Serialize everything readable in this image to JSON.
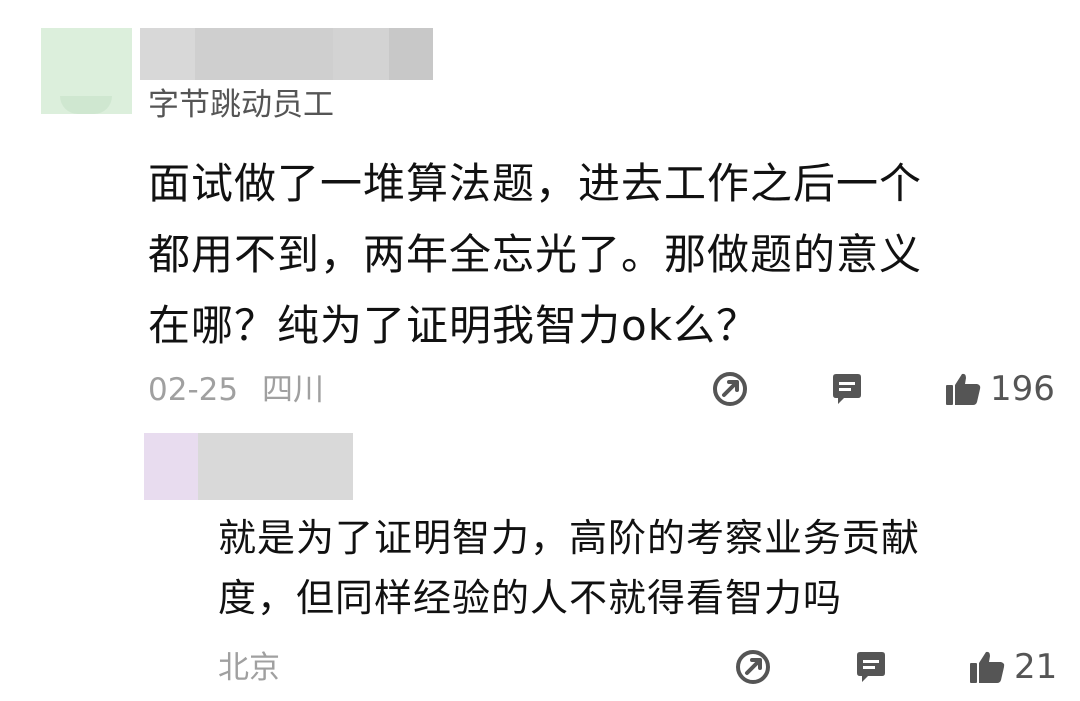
{
  "main_comment": {
    "author_tag": "字节跳动员工",
    "body_lines": [
      "面试做了一堆算法题，进去工作之后一个",
      "都用不到，两年全忘光了。那做题的意义",
      "在哪？纯为了证明我智力ok么？"
    ],
    "date": "02-25",
    "location": "四川",
    "like_count": "196"
  },
  "reply_comment": {
    "body_lines": [
      "就是为了证明智力，高阶的考察业务贡献",
      "度，但同样经验的人不就得看智力吗"
    ],
    "location": "北京",
    "like_count": "21"
  },
  "icons": {
    "share": "share-icon",
    "reply": "reply-icon",
    "like": "thumbs-up-icon"
  },
  "colors": {
    "icon": "#555555",
    "meta_text": "#a0a0a0",
    "body_text": "#111111"
  }
}
